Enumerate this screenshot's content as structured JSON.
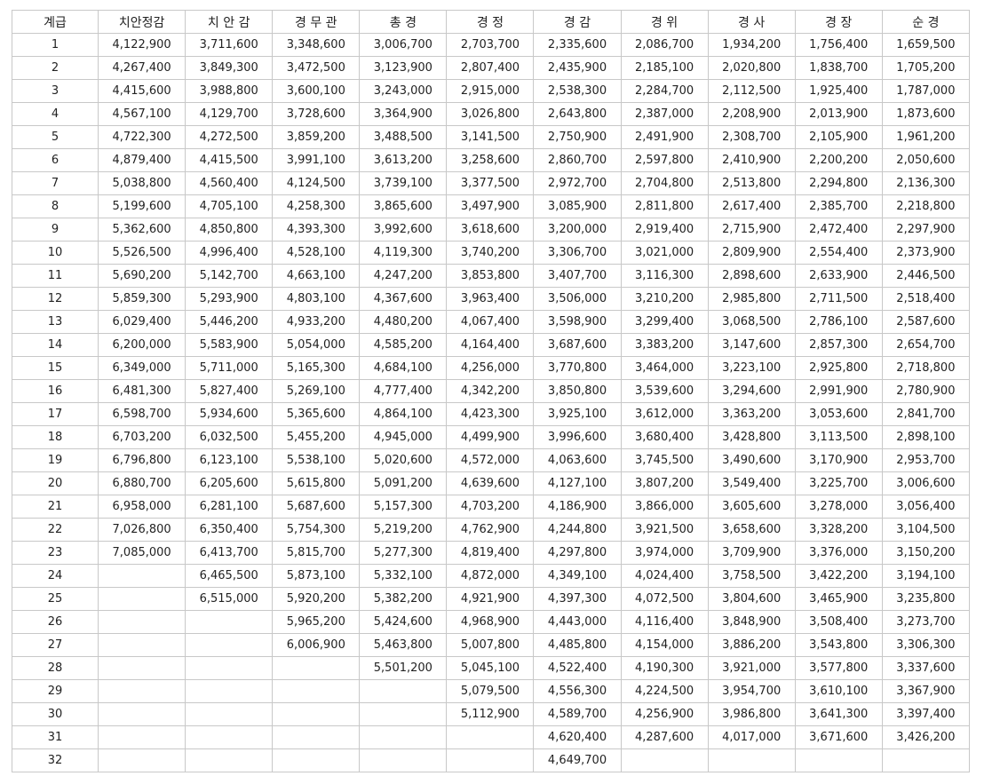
{
  "table": {
    "headers": [
      "계급",
      "치안정감",
      "치 안 감",
      "경 무 관",
      "총 경",
      "경 정",
      "경 감",
      "경 위",
      "경 사",
      "경 장",
      "순 경"
    ],
    "rows": [
      [
        "1",
        "4,122,900",
        "3,711,600",
        "3,348,600",
        "3,006,700",
        "2,703,700",
        "2,335,600",
        "2,086,700",
        "1,934,200",
        "1,756,400",
        "1,659,500"
      ],
      [
        "2",
        "4,267,400",
        "3,849,300",
        "3,472,500",
        "3,123,900",
        "2,807,400",
        "2,435,900",
        "2,185,100",
        "2,020,800",
        "1,838,700",
        "1,705,200"
      ],
      [
        "3",
        "4,415,600",
        "3,988,800",
        "3,600,100",
        "3,243,000",
        "2,915,000",
        "2,538,300",
        "2,284,700",
        "2,112,500",
        "1,925,400",
        "1,787,000"
      ],
      [
        "4",
        "4,567,100",
        "4,129,700",
        "3,728,600",
        "3,364,900",
        "3,026,800",
        "2,643,800",
        "2,387,000",
        "2,208,900",
        "2,013,900",
        "1,873,600"
      ],
      [
        "5",
        "4,722,300",
        "4,272,500",
        "3,859,200",
        "3,488,500",
        "3,141,500",
        "2,750,900",
        "2,491,900",
        "2,308,700",
        "2,105,900",
        "1,961,200"
      ],
      [
        "6",
        "4,879,400",
        "4,415,500",
        "3,991,100",
        "3,613,200",
        "3,258,600",
        "2,860,700",
        "2,597,800",
        "2,410,900",
        "2,200,200",
        "2,050,600"
      ],
      [
        "7",
        "5,038,800",
        "4,560,400",
        "4,124,500",
        "3,739,100",
        "3,377,500",
        "2,972,700",
        "2,704,800",
        "2,513,800",
        "2,294,800",
        "2,136,300"
      ],
      [
        "8",
        "5,199,600",
        "4,705,100",
        "4,258,300",
        "3,865,600",
        "3,497,900",
        "3,085,900",
        "2,811,800",
        "2,617,400",
        "2,385,700",
        "2,218,800"
      ],
      [
        "9",
        "5,362,600",
        "4,850,800",
        "4,393,300",
        "3,992,600",
        "3,618,600",
        "3,200,000",
        "2,919,400",
        "2,715,900",
        "2,472,400",
        "2,297,900"
      ],
      [
        "10",
        "5,526,500",
        "4,996,400",
        "4,528,100",
        "4,119,300",
        "3,740,200",
        "3,306,700",
        "3,021,000",
        "2,809,900",
        "2,554,400",
        "2,373,900"
      ],
      [
        "11",
        "5,690,200",
        "5,142,700",
        "4,663,100",
        "4,247,200",
        "3,853,800",
        "3,407,700",
        "3,116,300",
        "2,898,600",
        "2,633,900",
        "2,446,500"
      ],
      [
        "12",
        "5,859,300",
        "5,293,900",
        "4,803,100",
        "4,367,600",
        "3,963,400",
        "3,506,000",
        "3,210,200",
        "2,985,800",
        "2,711,500",
        "2,518,400"
      ],
      [
        "13",
        "6,029,400",
        "5,446,200",
        "4,933,200",
        "4,480,200",
        "4,067,400",
        "3,598,900",
        "3,299,400",
        "3,068,500",
        "2,786,100",
        "2,587,600"
      ],
      [
        "14",
        "6,200,000",
        "5,583,900",
        "5,054,000",
        "4,585,200",
        "4,164,400",
        "3,687,600",
        "3,383,200",
        "3,147,600",
        "2,857,300",
        "2,654,700"
      ],
      [
        "15",
        "6,349,000",
        "5,711,000",
        "5,165,300",
        "4,684,100",
        "4,256,000",
        "3,770,800",
        "3,464,000",
        "3,223,100",
        "2,925,800",
        "2,718,800"
      ],
      [
        "16",
        "6,481,300",
        "5,827,400",
        "5,269,100",
        "4,777,400",
        "4,342,200",
        "3,850,800",
        "3,539,600",
        "3,294,600",
        "2,991,900",
        "2,780,900"
      ],
      [
        "17",
        "6,598,700",
        "5,934,600",
        "5,365,600",
        "4,864,100",
        "4,423,300",
        "3,925,100",
        "3,612,000",
        "3,363,200",
        "3,053,600",
        "2,841,700"
      ],
      [
        "18",
        "6,703,200",
        "6,032,500",
        "5,455,200",
        "4,945,000",
        "4,499,900",
        "3,996,600",
        "3,680,400",
        "3,428,800",
        "3,113,500",
        "2,898,100"
      ],
      [
        "19",
        "6,796,800",
        "6,123,100",
        "5,538,100",
        "5,020,600",
        "4,572,000",
        "4,063,600",
        "3,745,500",
        "3,490,600",
        "3,170,900",
        "2,953,700"
      ],
      [
        "20",
        "6,880,700",
        "6,205,600",
        "5,615,800",
        "5,091,200",
        "4,639,600",
        "4,127,100",
        "3,807,200",
        "3,549,400",
        "3,225,700",
        "3,006,600"
      ],
      [
        "21",
        "6,958,000",
        "6,281,100",
        "5,687,600",
        "5,157,300",
        "4,703,200",
        "4,186,900",
        "3,866,000",
        "3,605,600",
        "3,278,000",
        "3,056,400"
      ],
      [
        "22",
        "7,026,800",
        "6,350,400",
        "5,754,300",
        "5,219,200",
        "4,762,900",
        "4,244,800",
        "3,921,500",
        "3,658,600",
        "3,328,200",
        "3,104,500"
      ],
      [
        "23",
        "7,085,000",
        "6,413,700",
        "5,815,700",
        "5,277,300",
        "4,819,400",
        "4,297,800",
        "3,974,000",
        "3,709,900",
        "3,376,000",
        "3,150,200"
      ],
      [
        "24",
        "",
        "6,465,500",
        "5,873,100",
        "5,332,100",
        "4,872,000",
        "4,349,100",
        "4,024,400",
        "3,758,500",
        "3,422,200",
        "3,194,100"
      ],
      [
        "25",
        "",
        "6,515,000",
        "5,920,200",
        "5,382,200",
        "4,921,900",
        "4,397,300",
        "4,072,500",
        "3,804,600",
        "3,465,900",
        "3,235,800"
      ],
      [
        "26",
        "",
        "",
        "5,965,200",
        "5,424,600",
        "4,968,900",
        "4,443,000",
        "4,116,400",
        "3,848,900",
        "3,508,400",
        "3,273,700"
      ],
      [
        "27",
        "",
        "",
        "6,006,900",
        "5,463,800",
        "5,007,800",
        "4,485,800",
        "4,154,000",
        "3,886,200",
        "3,543,800",
        "3,306,300"
      ],
      [
        "28",
        "",
        "",
        "",
        "5,501,200",
        "5,045,100",
        "4,522,400",
        "4,190,300",
        "3,921,000",
        "3,577,800",
        "3,337,600"
      ],
      [
        "29",
        "",
        "",
        "",
        "",
        "5,079,500",
        "4,556,300",
        "4,224,500",
        "3,954,700",
        "3,610,100",
        "3,367,900"
      ],
      [
        "30",
        "",
        "",
        "",
        "",
        "5,112,900",
        "4,589,700",
        "4,256,900",
        "3,986,800",
        "3,641,300",
        "3,397,400"
      ],
      [
        "31",
        "",
        "",
        "",
        "",
        "",
        "4,620,400",
        "4,287,600",
        "4,017,000",
        "3,671,600",
        "3,426,200"
      ],
      [
        "32",
        "",
        "",
        "",
        "",
        "",
        "4,649,700",
        "",
        "",
        "",
        ""
      ]
    ]
  }
}
